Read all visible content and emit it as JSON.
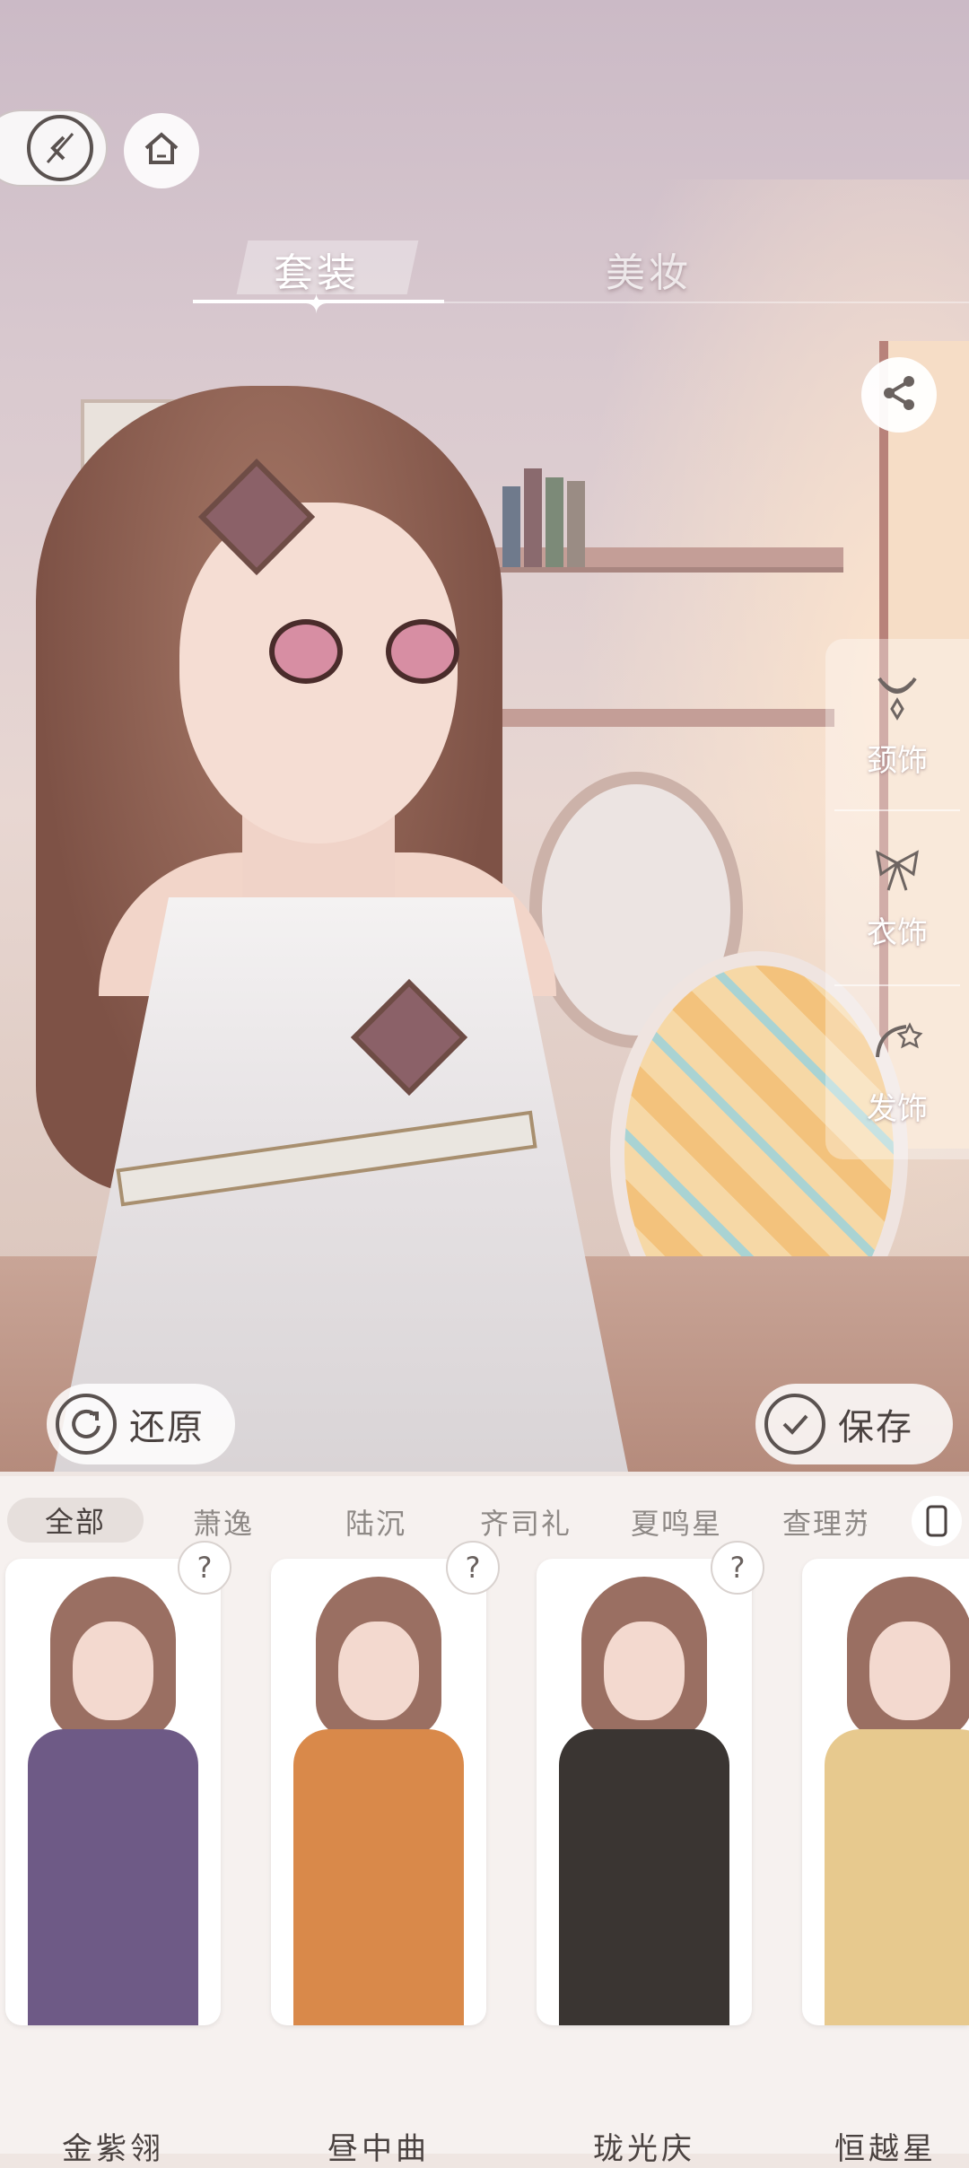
{
  "top_nav": {
    "back_icon": "back-icon",
    "home_icon": "home-icon"
  },
  "tabs": [
    {
      "label": "套装",
      "active": true
    },
    {
      "label": "美妆",
      "active": false
    }
  ],
  "share_icon": "share-icon",
  "side_menu": [
    {
      "label": "颈饰",
      "icon": "necklace-icon"
    },
    {
      "label": "衣饰",
      "icon": "bow-icon"
    },
    {
      "label": "发饰",
      "icon": "hairpin-icon"
    }
  ],
  "actions": {
    "reset_label": "还原",
    "save_label": "保存"
  },
  "filters": [
    "全部",
    "萧逸",
    "陆沉",
    "齐司礼",
    "夏鸣星",
    "查理苏"
  ],
  "cards": [
    {
      "name": "金紫翎",
      "question": "?",
      "outfit_color": "#6e5a86"
    },
    {
      "name": "昼中曲",
      "question": "?",
      "outfit_color": "#d9894a"
    },
    {
      "name": "珑光庆",
      "question": "?",
      "outfit_color": "#3a3532"
    },
    {
      "name": "恒越星",
      "question": "",
      "outfit_color": "#e7c98e"
    }
  ],
  "colors": {
    "panel_bg": "#f6f1ef",
    "text_dark": "#4a4240",
    "text_muted": "#8e8986"
  }
}
